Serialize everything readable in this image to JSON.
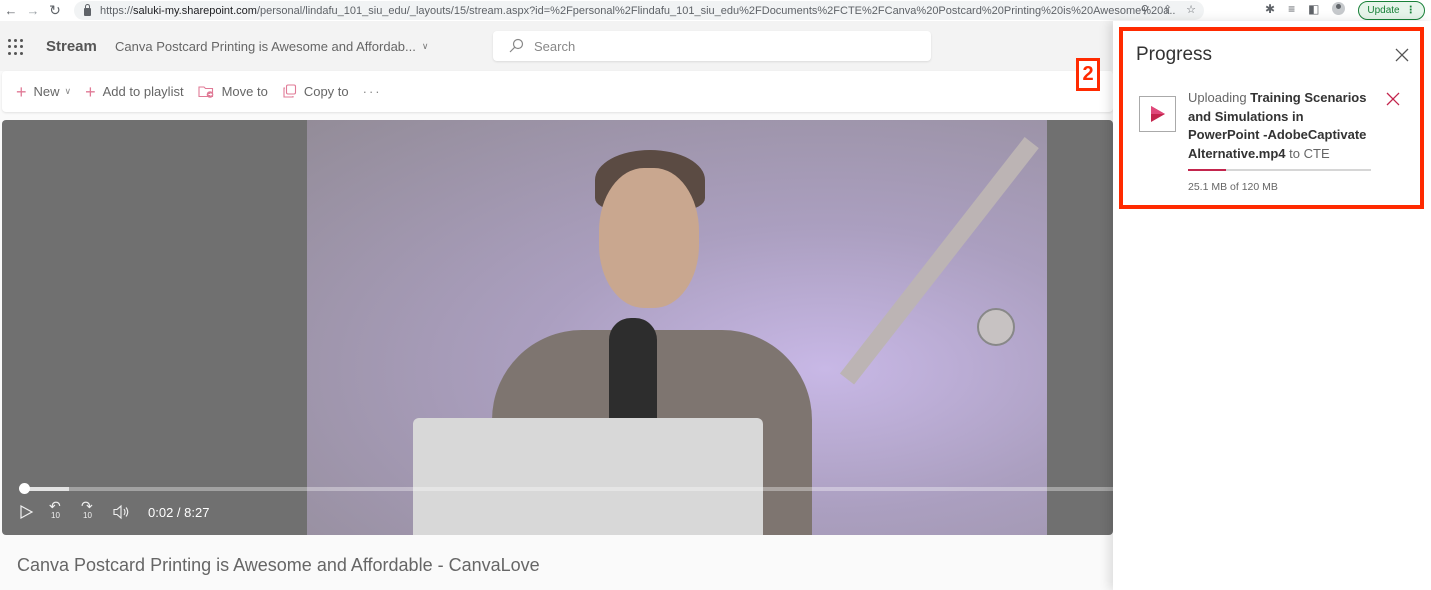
{
  "browser": {
    "url_prefix": "https://",
    "url_host": "saluki-my.sharepoint.com",
    "url_path": "/personal/lindafu_101_siu_edu/_layouts/15/stream.aspx?id=%2Fpersonal%2Flindafu_101_siu_edu%2FDocuments%2FCTE%2FCanva%20Postcard%20Printing%20is%20Awesome%20a...",
    "update_label": "Update",
    "icons": [
      "back-icon",
      "forward-icon",
      "reload-icon",
      "lock-icon",
      "zoom-icon",
      "share-icon",
      "bookmark-star-icon",
      "extensions-icon",
      "reading-list-icon",
      "side-panel-icon",
      "profile-icon",
      "more-icon"
    ]
  },
  "header": {
    "app_name": "Stream",
    "breadcrumb": "Canva Postcard Printing is Awesome and Affordab...",
    "search_placeholder": "Search"
  },
  "commandbar": {
    "items": [
      {
        "label": "New",
        "icon": "plus-icon",
        "has_dropdown": true
      },
      {
        "label": "Add to playlist",
        "icon": "plus-icon"
      },
      {
        "label": "Move to",
        "icon": "move-folder-icon"
      },
      {
        "label": "Copy to",
        "icon": "copy-icon"
      }
    ],
    "more_label": "···"
  },
  "annotation": {
    "label": "2",
    "color": "#ff2a00"
  },
  "player": {
    "time_current": "0:02",
    "time_separator": " / ",
    "time_total": "8:27",
    "played_fraction": 0.004,
    "buffered_fraction": 0.045,
    "skip_back_seconds": "10",
    "skip_forward_seconds": "10"
  },
  "video": {
    "title": "Canva Postcard Printing is Awesome and Affordable - CanvaLove"
  },
  "progress_panel": {
    "title": "Progress",
    "upload": {
      "prefix": "Uploading ",
      "filename": "Training Scenarios and Simulations in PowerPoint -AdobeCaptivate Alternative.mp4",
      "suffix": " to CTE",
      "uploaded": "25.1 MB",
      "of_label": " of ",
      "total": "120 MB",
      "progress_fraction": 0.209
    },
    "accent_color": "#c3254d"
  }
}
